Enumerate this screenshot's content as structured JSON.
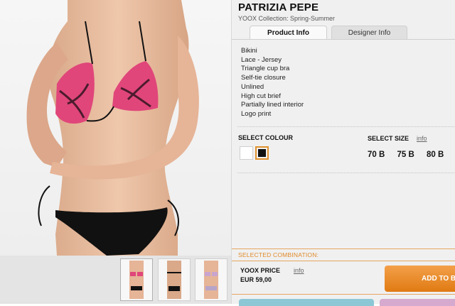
{
  "product": {
    "brand": "PATRIZIA PEPE",
    "collection": "YOOX Collection: Spring-Summer"
  },
  "tabs": [
    {
      "label": "Product Info",
      "active": true
    },
    {
      "label": "Designer Info",
      "active": false
    }
  ],
  "description": [
    "Bikini",
    "Lace - Jersey",
    "Triangle cup bra",
    "Self-tie closure",
    "Unlined",
    "High cut brief",
    "Partially lined interior",
    "Logo print"
  ],
  "colour": {
    "label": "SELECT COLOUR",
    "swatches": [
      {
        "color": "#ffffff",
        "selected": false
      },
      {
        "color": "#111111",
        "selected": true
      }
    ]
  },
  "size": {
    "label": "SELECT SIZE",
    "info_link": "info",
    "options": [
      "70 B",
      "75 B",
      "80 B"
    ]
  },
  "combination": {
    "label": "SELECTED COMBINATION:",
    "price_label": "YOOX PRICE",
    "price_info": "info",
    "price": "EUR 59,00",
    "add_button": "ADD TO BAG"
  },
  "colors": {
    "accent": "#e07a12",
    "combo_text": "#e08a2a",
    "bikini_pink": "#e0467a",
    "bikini_black": "#111111"
  }
}
